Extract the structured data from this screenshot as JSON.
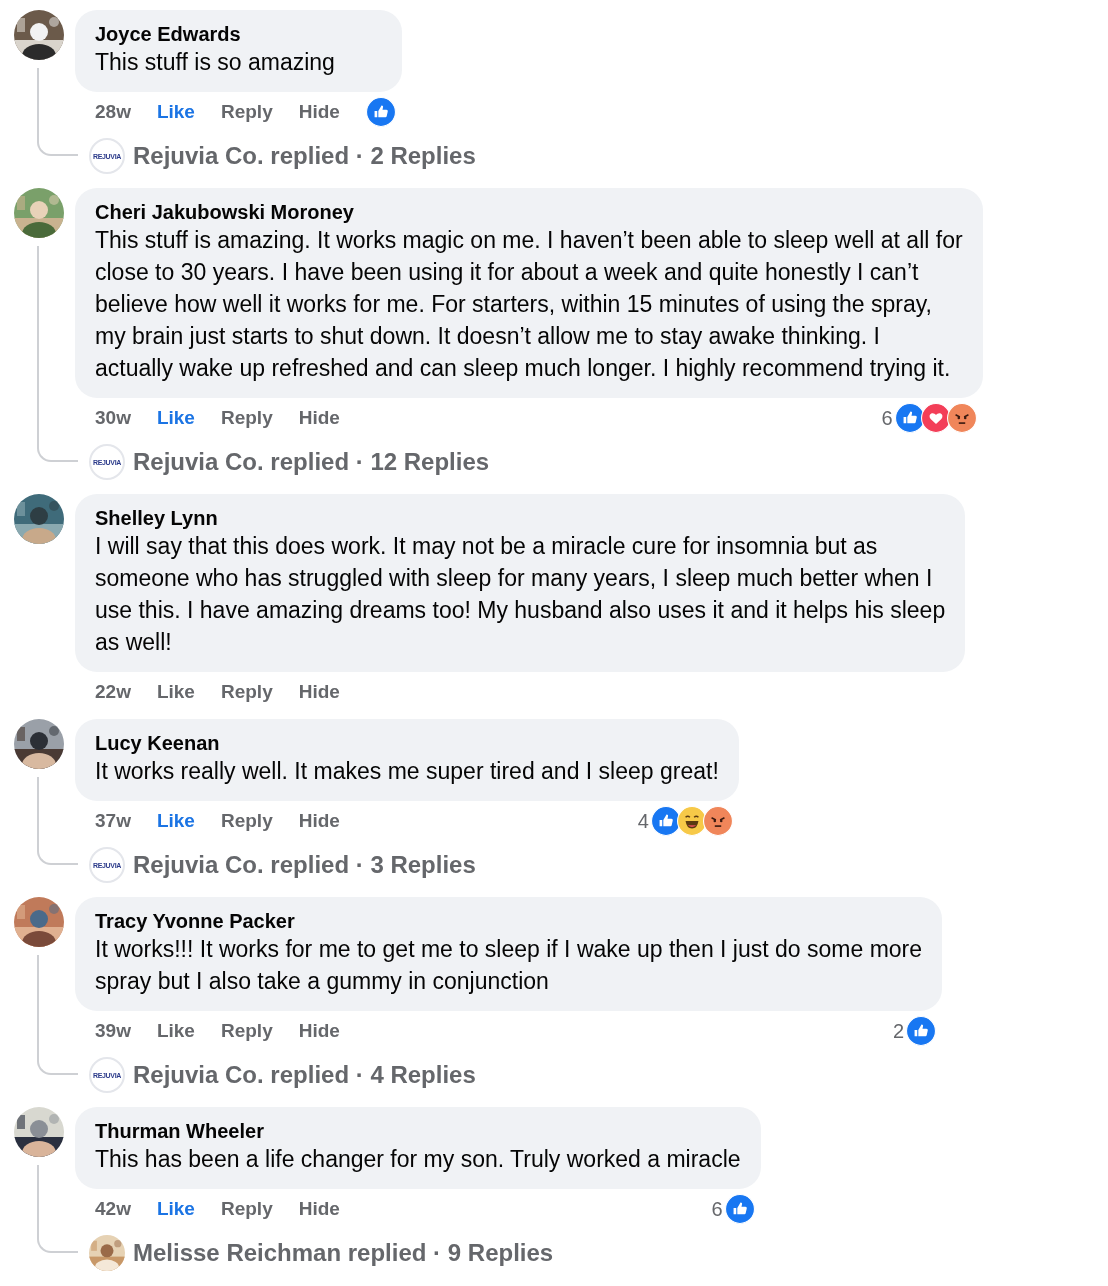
{
  "comments": [
    {
      "author": "Joyce Edwards",
      "lines": [
        "This stuff is so amazing"
      ],
      "time": "28w",
      "like": "Like",
      "liked": true,
      "reply": "Reply",
      "hide": "Hide",
      "reactions": {
        "icons": [
          {
            "kind": "like"
          }
        ]
      },
      "replies": {
        "avatar": {
          "kind": "logo",
          "text": "REJUVIA"
        },
        "text": "Rejuvia Co. replied · 2 Replies"
      }
    },
    {
      "author": "Cheri Jakubowski Moroney",
      "lines": [
        "This stuff is amazing. It works magic on me. I haven’t been able to sleep well at all for",
        "close to 30 years. I have been using it for about a week and quite honestly I can’t",
        "believe how well it works for me. For starters, within 15 minutes of using the spray,",
        "my brain just starts to shut down. It doesn’t allow me to stay awake thinking. I",
        "actually wake up refreshed and can sleep much longer. I highly recommend trying it."
      ],
      "time": "30w",
      "like": "Like",
      "liked": true,
      "reply": "Reply",
      "hide": "Hide",
      "reactions": {
        "count": "6",
        "icons": [
          {
            "kind": "like"
          },
          {
            "kind": "love"
          },
          {
            "kind": "angry"
          }
        ]
      },
      "replies": {
        "avatar": {
          "kind": "logo",
          "text": "REJUVIA"
        },
        "text": "Rejuvia Co. replied · 12 Replies"
      }
    },
    {
      "author": "Shelley Lynn",
      "lines": [
        "I will say that this does work. It may not be a miracle cure for insomnia but as",
        "someone who has struggled with sleep for many years, I sleep much better when I",
        "use this. I have amazing dreams too! My husband also uses it and it helps his sleep",
        "as well!"
      ],
      "time": "22w",
      "like": "Like",
      "liked": false,
      "reply": "Reply",
      "hide": "Hide"
    },
    {
      "author": "Lucy Keenan",
      "lines": [
        "It works really well. It makes me super tired and I sleep great!"
      ],
      "time": "37w",
      "like": "Like",
      "liked": true,
      "reply": "Reply",
      "hide": "Hide",
      "reactions": {
        "count": "4",
        "icons": [
          {
            "kind": "like"
          },
          {
            "kind": "haha"
          },
          {
            "kind": "angry"
          }
        ]
      },
      "replies": {
        "avatar": {
          "kind": "logo",
          "text": "REJUVIA"
        },
        "text": "Rejuvia Co. replied · 3 Replies"
      }
    },
    {
      "author": "Tracy Yvonne Packer",
      "lines": [
        "It works!!! It works for me to get me to sleep if I wake up then I just do some more",
        "spray but I also take a gummy in conjunction"
      ],
      "time": "39w",
      "like": "Like",
      "liked": false,
      "reply": "Reply",
      "hide": "Hide",
      "reactions": {
        "count": "2",
        "icons": [
          {
            "kind": "like"
          }
        ]
      },
      "replies": {
        "avatar": {
          "kind": "logo",
          "text": "REJUVIA"
        },
        "text": "Rejuvia Co. replied · 4 Replies"
      }
    },
    {
      "author": "Thurman Wheeler",
      "lines": [
        "This has been a life changer for my son. Truly worked a miracle"
      ],
      "time": "42w",
      "like": "Like",
      "liked": true,
      "reply": "Reply",
      "hide": "Hide",
      "reactions": {
        "count": "6",
        "icons": [
          {
            "kind": "like"
          }
        ]
      },
      "replies": {
        "text": "Melisse Reichman replied · 9 Replies"
      }
    }
  ]
}
